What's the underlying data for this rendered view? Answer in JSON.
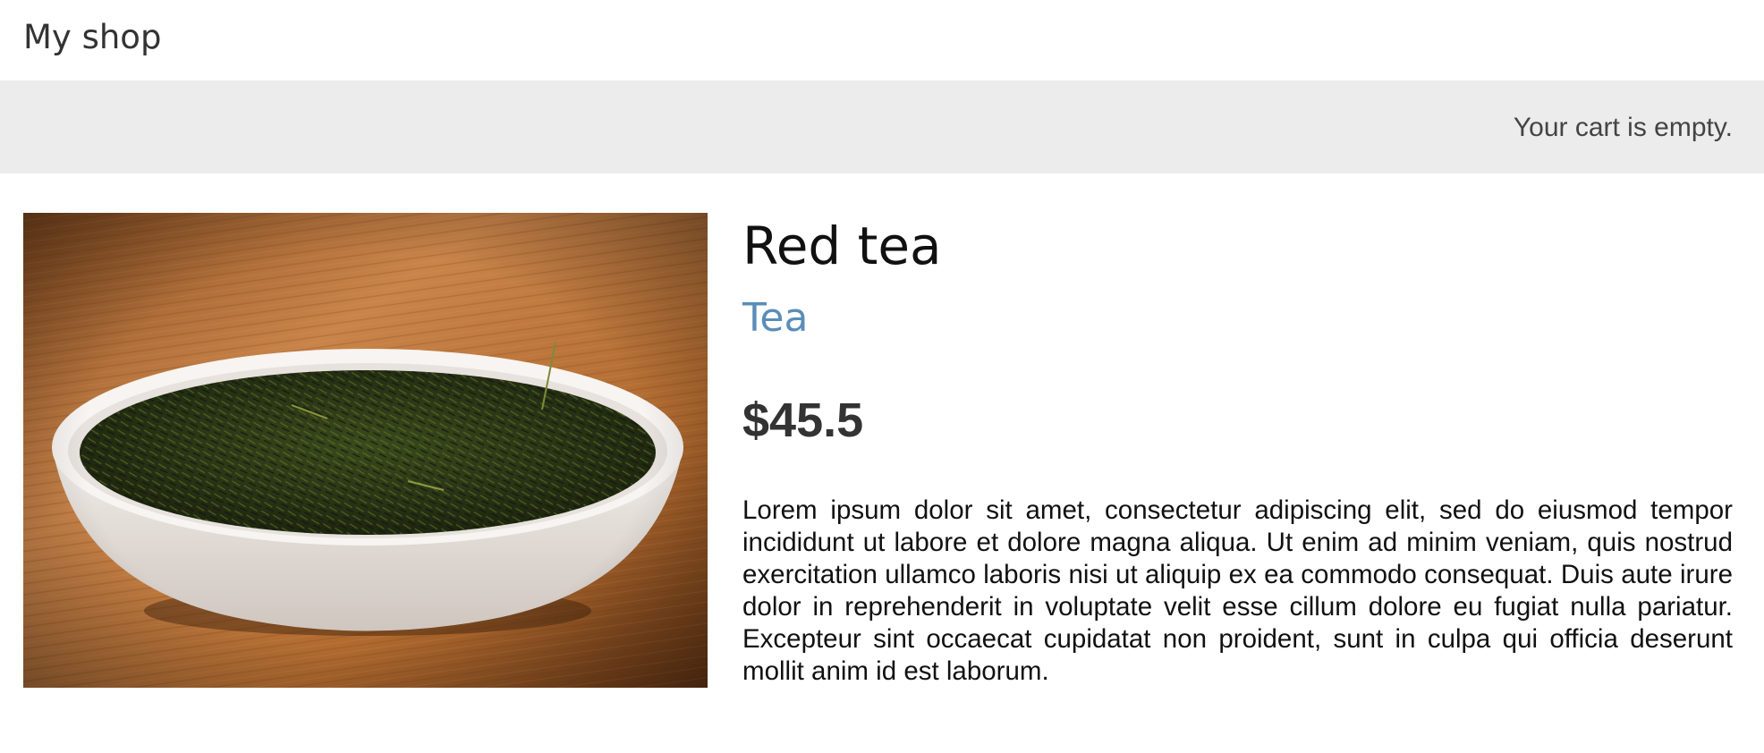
{
  "header": {
    "title": "My shop"
  },
  "cart": {
    "status": "Your cart is empty."
  },
  "product": {
    "image_icon": "tea-bowl-image",
    "name": "Red tea",
    "category": "Tea",
    "price": "$45.5",
    "description": "Lorem ipsum dolor sit amet, consectetur adipiscing elit, sed do eiusmod tempor incididunt ut labore et dolore magna aliqua. Ut enim ad minim veniam, quis nostrud exercitation ullamco laboris nisi ut aliquip ex ea commodo consequat. Duis aute irure dolor in reprehenderit in voluptate velit esse cillum dolore eu fugiat nulla pariatur. Excepteur sint occaecat cupidatat non proident, sunt in culpa qui officia deserunt mollit anim id est laborum."
  },
  "colors": {
    "cart_bar_bg": "#ececec",
    "category_link": "#5b8db8",
    "text_dark": "#333333"
  }
}
